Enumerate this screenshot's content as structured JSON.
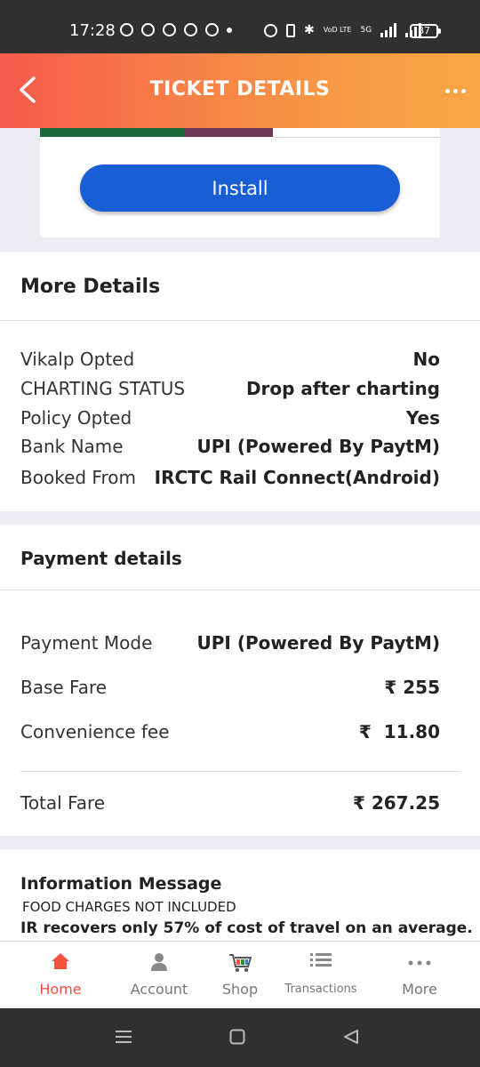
{
  "status_bar": {
    "time": "17:28",
    "network": "VoD LTE",
    "network_type": "5G",
    "battery": "87"
  },
  "header": {
    "title": "TICKET DETAILS"
  },
  "ad": {
    "install_label": "Install"
  },
  "more_details": {
    "title": "More Details",
    "rows": [
      {
        "label": "Vikalp Opted",
        "value": "No"
      },
      {
        "label": "CHARTING STATUS",
        "value": "Drop after charting"
      },
      {
        "label": "Policy Opted",
        "value": "Yes"
      },
      {
        "label": "Bank Name",
        "value": "UPI (Powered By PaytM)"
      },
      {
        "label": "Booked From",
        "value": "IRCTC Rail Connect(Android)"
      }
    ]
  },
  "payment": {
    "title": "Payment details",
    "rows": [
      {
        "label": "Payment Mode",
        "value": "UPI (Powered By PaytM)"
      },
      {
        "label": "Base Fare",
        "value": "₹ 255"
      },
      {
        "label": "Convenience fee",
        "value": "₹  11.80"
      }
    ],
    "total_label": "Total Fare",
    "total_value": "₹ 267.25"
  },
  "info": {
    "title": "Information Message",
    "line1": "FOOD CHARGES NOT INCLUDED",
    "line2": "IR recovers only 57% of cost of travel on an average."
  },
  "bottom_nav": {
    "items": [
      {
        "label": "Home",
        "icon": "home-icon"
      },
      {
        "label": "Account",
        "icon": "account-icon"
      },
      {
        "label": "Shop",
        "icon": "shop-cart-icon"
      },
      {
        "label": "Transactions",
        "icon": "list-icon"
      },
      {
        "label": "More",
        "icon": "more-dots-icon"
      }
    ]
  },
  "colors": {
    "accent": "#f4523e",
    "header_start": "#f65a4c",
    "header_end": "#f7a645",
    "install_button": "#1a5ed6"
  }
}
